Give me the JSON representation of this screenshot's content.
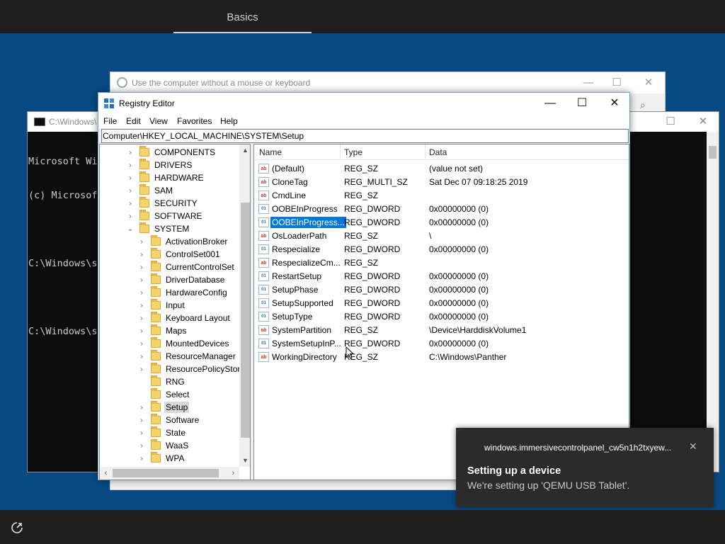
{
  "oobe": {
    "tab": "Basics"
  },
  "ease_window": {
    "title": "Use the computer without a mouse or keyboard",
    "minimize": "—",
    "maximize": "☐",
    "close": "✕",
    "search": "⌕"
  },
  "cmd_window": {
    "title": "C:\\Windows\\",
    "lines": [
      "Microsoft Win",
      "(c) Microsoft",
      "",
      "C:\\Windows\\sy",
      "",
      "C:\\Windows\\sy"
    ],
    "maximize": "☐",
    "close": "✕"
  },
  "regedit": {
    "title": "Registry Editor",
    "minimize": "—",
    "maximize": "☐",
    "close": "✕",
    "menu": [
      "File",
      "Edit",
      "View",
      "Favorites",
      "Help"
    ],
    "address": "Computer\\HKEY_LOCAL_MACHINE\\SYSTEM\\Setup",
    "tree": {
      "top_keys": [
        "COMPONENTS",
        "DRIVERS",
        "HARDWARE",
        "SAM",
        "SECURITY",
        "SOFTWARE",
        "SYSTEM"
      ],
      "system_children": [
        "ActivationBroker",
        "ControlSet001",
        "CurrentControlSet",
        "DriverDatabase",
        "HardwareConfig",
        "Input",
        "Keyboard Layout",
        "Maps",
        "MountedDevices",
        "ResourceManager",
        "ResourcePolicyStore",
        "RNG",
        "Select",
        "Setup",
        "Software",
        "State",
        "WaaS",
        "WPA"
      ],
      "selected": "Setup"
    },
    "columns": {
      "name": "Name",
      "type": "Type",
      "data": "Data"
    },
    "values": [
      {
        "icon": "ab",
        "name": "(Default)",
        "type": "REG_SZ",
        "data": "(value not set)"
      },
      {
        "icon": "ab",
        "name": "CloneTag",
        "type": "REG_MULTI_SZ",
        "data": "Sat Dec 07 09:18:25 2019"
      },
      {
        "icon": "ab",
        "name": "CmdLine",
        "type": "REG_SZ",
        "data": ""
      },
      {
        "icon": "01",
        "name": "OOBEInProgress",
        "type": "REG_DWORD",
        "data": "0x00000000 (0)"
      },
      {
        "icon": "01",
        "name": "OOBEInProgress...",
        "type": "REG_DWORD",
        "data": "0x00000000 (0)"
      },
      {
        "icon": "ab",
        "name": "OsLoaderPath",
        "type": "REG_SZ",
        "data": "\\"
      },
      {
        "icon": "01",
        "name": "Respecialize",
        "type": "REG_DWORD",
        "data": "0x00000000 (0)"
      },
      {
        "icon": "ab",
        "name": "RespecializeCm...",
        "type": "REG_SZ",
        "data": ""
      },
      {
        "icon": "01",
        "name": "RestartSetup",
        "type": "REG_DWORD",
        "data": "0x00000000 (0)"
      },
      {
        "icon": "01",
        "name": "SetupPhase",
        "type": "REG_DWORD",
        "data": "0x00000000 (0)"
      },
      {
        "icon": "01",
        "name": "SetupSupported",
        "type": "REG_DWORD",
        "data": "0x00000000 (0)"
      },
      {
        "icon": "01",
        "name": "SetupType",
        "type": "REG_DWORD",
        "data": "0x00000000 (0)"
      },
      {
        "icon": "ab",
        "name": "SystemPartition",
        "type": "REG_SZ",
        "data": "\\Device\\HarddiskVolume1"
      },
      {
        "icon": "01",
        "name": "SystemSetupInP...",
        "type": "REG_DWORD",
        "data": "0x00000000 (0)"
      },
      {
        "icon": "ab",
        "name": "WorkingDirectory",
        "type": "REG_SZ",
        "data": "C:\\Windows\\Panther"
      }
    ],
    "selected_value": "OOBEInProgress..."
  },
  "toast": {
    "app": "windows.immersivecontrolpanel_cw5n1h2txyew...",
    "close": "✕",
    "title": "Setting up a device",
    "body": "We're setting up 'QEMU USB Tablet'."
  },
  "colors": {
    "desktop": "#0a4a84",
    "selection": "#0078d7",
    "toast_bg": "#2b2b2b"
  }
}
